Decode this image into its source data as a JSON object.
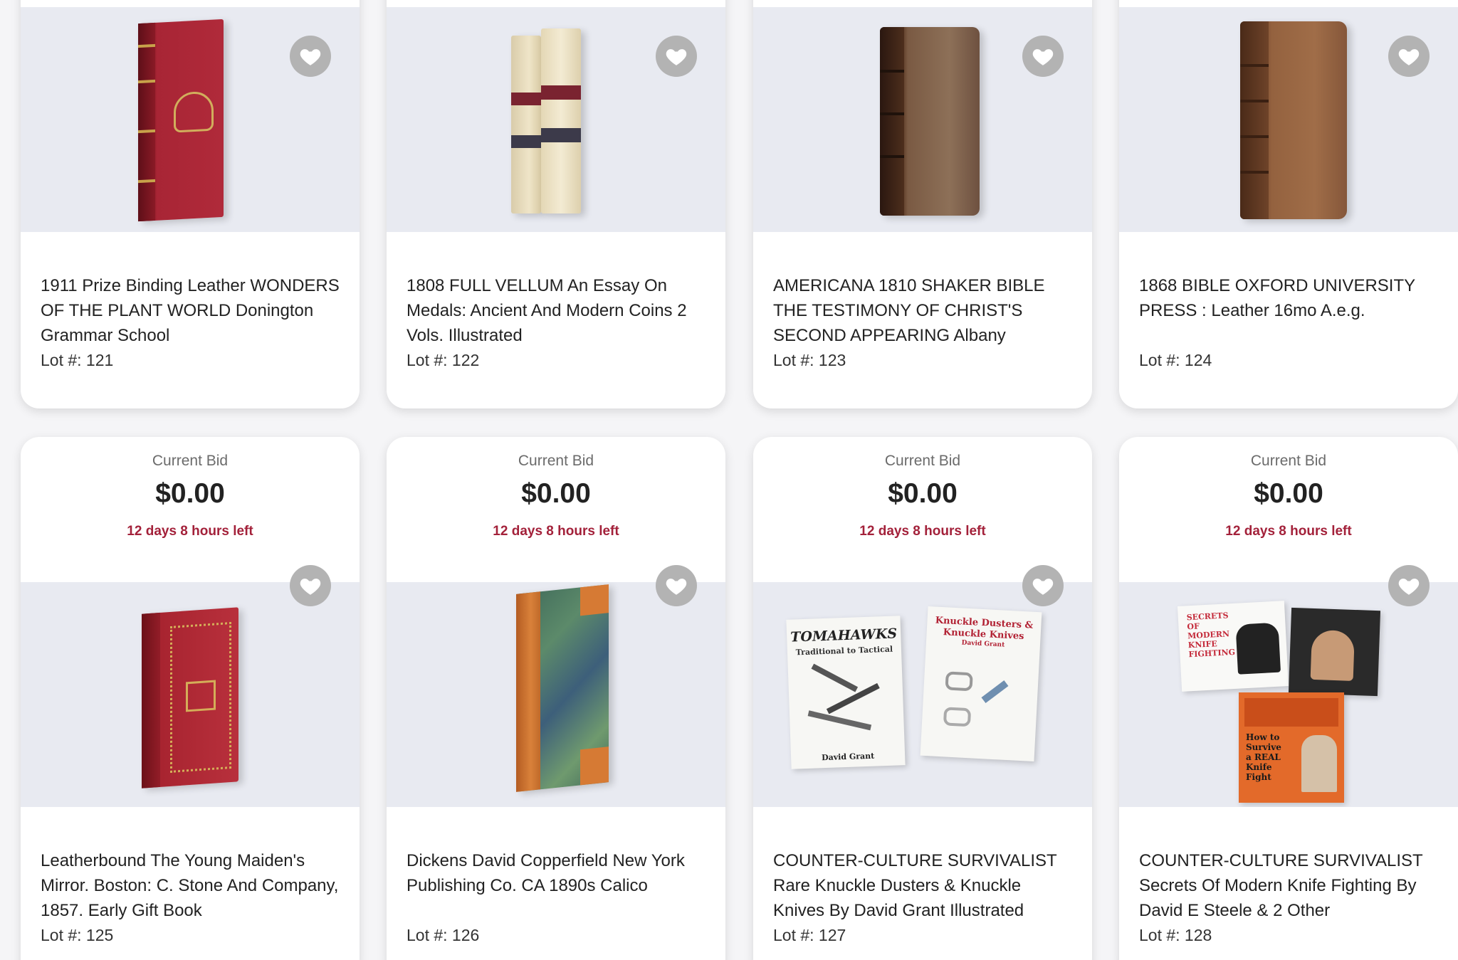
{
  "row1": [
    {
      "title": "1911 Prize Binding Leather WONDERS OF THE PLANT WORLD Donington Grammar School",
      "lot": "Lot #: 121"
    },
    {
      "title": "1808 FULL VELLUM An Essay On Medals: Ancient And Modern Coins 2 Vols. Illustrated",
      "lot": "Lot #: 122"
    },
    {
      "title": "AMERICANA 1810 SHAKER BIBLE THE TESTIMONY OF CHRIST'S SECOND APPEARING Albany",
      "lot": "Lot #: 123"
    },
    {
      "title": "1868 BIBLE OXFORD UNIVERSITY PRESS : Leather 16mo A.e.g.",
      "lot": "Lot #: 124"
    }
  ],
  "row2": [
    {
      "bid_label": "Current Bid",
      "bid_amount": "$0.00",
      "time_left": "12 days 8 hours left",
      "title": "Leatherbound The Young Maiden's Mirror. Boston: C. Stone And Company, 1857. Early Gift Book",
      "lot": "Lot #: 125"
    },
    {
      "bid_label": "Current Bid",
      "bid_amount": "$0.00",
      "time_left": "12 days 8 hours left",
      "title": "Dickens David Copperfield New York Publishing Co. CA 1890s Calico",
      "lot": "Lot #: 126"
    },
    {
      "bid_label": "Current Bid",
      "bid_amount": "$0.00",
      "time_left": "12 days 8 hours left",
      "title": "COUNTER-CULTURE SURVIVALIST Rare Knuckle Dusters & Knuckle Knives By David Grant Illustrated",
      "lot": "Lot #: 127",
      "cover_texts": [
        "TOMAHAWKS",
        "Traditional to Tactical",
        "David Grant",
        "Knuckle Dusters & Knuckle Knives",
        "David Grant"
      ]
    },
    {
      "bid_label": "Current Bid",
      "bid_amount": "$0.00",
      "time_left": "12 days 8 hours left",
      "title": "COUNTER-CULTURE SURVIVALIST Secrets Of Modern Knife Fighting By David E Steele & 2 Other",
      "lot": "Lot #: 128",
      "cover_texts": [
        "SECRETS OF MODERN KNIFE FIGHTING",
        "How to Survive a REAL Knife Fight"
      ]
    }
  ],
  "colors": {
    "time_left": "#a3213a",
    "heart_bg": "#b3b3b3",
    "image_bg": "#e8eaf1"
  },
  "icons": {
    "favorite": "heart-icon"
  }
}
